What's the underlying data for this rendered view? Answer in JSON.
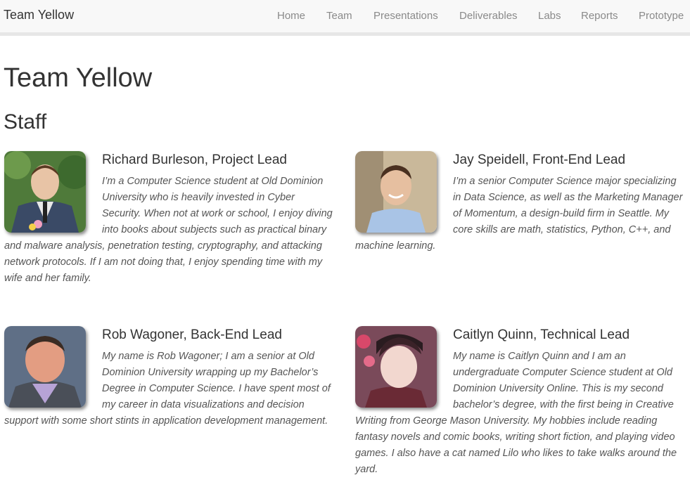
{
  "navbar": {
    "brand": "Team Yellow",
    "links": [
      "Home",
      "Team",
      "Presentations",
      "Deliverables",
      "Labs",
      "Reports",
      "Prototype"
    ]
  },
  "page": {
    "title": "Team Yellow",
    "section": "Staff"
  },
  "members": [
    {
      "name": "Richard Burleson, Project Lead",
      "bio": "I’m a Computer Science student at Old Dominion University who is heavily invested in Cyber Security. When not at work or school, I enjoy diving into books about subjects such as practical binary and malware analysis, penetration testing, cryptography, and attacking network protocols. If I am not doing that, I enjoy spending time with my wife and her family."
    },
    {
      "name": "Jay Speidell, Front-End Lead",
      "bio": "I’m a senior Computer Science major specializing in Data Science, as well as the Marketing Manager of Momentum, a design-build firm in Seattle. My core skills are math, statistics, Python, C++, and machine learning."
    },
    {
      "name": "Rob Wagoner, Back-End Lead",
      "bio": "My name is Rob Wagoner; I am a senior at Old Dominion University wrapping up my Bachelor’s Degree in Computer Science. I have spent most of my career in data visualizations and decision support with some short stints in application development management."
    },
    {
      "name": "Caitlyn Quinn, Technical Lead",
      "bio": "My name is Caitlyn Quinn and I am an undergraduate Computer Science student at Old Dominion University Online. This is my second bachelor’s degree, with the first being in Creative Writing from George Mason University. My hobbies include reading fantasy novels and comic books, writing short fiction, and playing video games. I also have a cat named Lilo who likes to take walks around the yard."
    }
  ]
}
